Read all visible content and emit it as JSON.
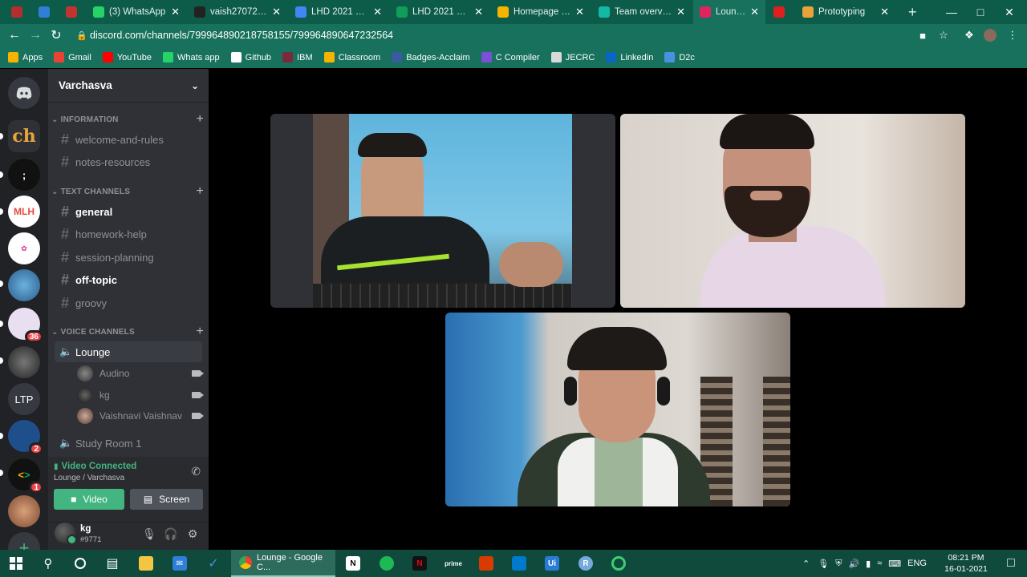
{
  "browser": {
    "tabs": [
      {
        "label": "",
        "color": "#b52e2e",
        "active": false
      },
      {
        "label": "",
        "color": "#2f7fd8",
        "active": false
      },
      {
        "label": "",
        "color": "#c4332f",
        "active": false
      },
      {
        "label": "(3) WhatsApp",
        "color": "#25d366",
        "active": false
      },
      {
        "label": "vaish27072001/",
        "color": "#222222",
        "active": false
      },
      {
        "label": "LHD 2021 Varch",
        "color": "#4285f4",
        "active": false
      },
      {
        "label": "LHD 2021 Varch",
        "color": "#0f9d58",
        "active": false
      },
      {
        "label": "Homepage - Go",
        "color": "#f4b400",
        "active": false
      },
      {
        "label": "Team overview |",
        "color": "#14b8a6",
        "active": false
      },
      {
        "label": "Lounge",
        "color": "#e0245e",
        "active": true
      },
      {
        "label": "",
        "color": "#e02020",
        "active": false
      },
      {
        "label": "Prototyping",
        "color": "#e9a33b",
        "active": false
      }
    ],
    "new_tab": "+",
    "url": "discord.com/channels/799964890218758155/799964890647232564",
    "bookmarks": [
      {
        "label": "Apps",
        "color": "#f4b400"
      },
      {
        "label": "Gmail",
        "color": "#ea4335"
      },
      {
        "label": "YouTube",
        "color": "#ff0000"
      },
      {
        "label": "Whats app",
        "color": "#25d366"
      },
      {
        "label": "Github",
        "color": "#ffffff"
      },
      {
        "label": "IBM",
        "color": "#7a2b3b"
      },
      {
        "label": "Classroom",
        "color": "#f4b400"
      },
      {
        "label": "Badges-Acclaim",
        "color": "#3a5ba0"
      },
      {
        "label": "C Compiler",
        "color": "#7b4fd6"
      },
      {
        "label": "JECRC",
        "color": "#d9d9d9"
      },
      {
        "label": "Linkedin",
        "color": "#0a66c2"
      },
      {
        "label": "D2c",
        "color": "#4a90e2"
      }
    ]
  },
  "discord": {
    "guild_name": "Varchasva",
    "categories": {
      "information": "INFORMATION",
      "text": "TEXT CHANNELS",
      "voice": "VOICE CHANNELS"
    },
    "info_channels": [
      "welcome-and-rules",
      "notes-resources"
    ],
    "text_channels": [
      {
        "name": "general",
        "unread": true
      },
      {
        "name": "homework-help",
        "unread": false
      },
      {
        "name": "session-planning",
        "unread": false
      },
      {
        "name": "off-topic",
        "unread": true
      },
      {
        "name": "groovy",
        "unread": false
      }
    ],
    "voice_channel": "Lounge",
    "voice_users": [
      "Audino",
      "kg",
      "Vaishnavi Vaishnav"
    ],
    "voice_channel_2": "Study Room 1",
    "server_ltp": "LTP",
    "server_badges": [
      "36",
      "2",
      "1"
    ],
    "voice_status": "Video Connected",
    "voice_location": "Lounge / Varchasva",
    "video_button": "Video",
    "screen_button": "Screen",
    "username": "kg",
    "discriminator": "#9771"
  },
  "taskbar": {
    "chrome_label": "Lounge - Google C...",
    "language": "ENG",
    "time": "08:21 PM",
    "date": "16-01-2021"
  }
}
